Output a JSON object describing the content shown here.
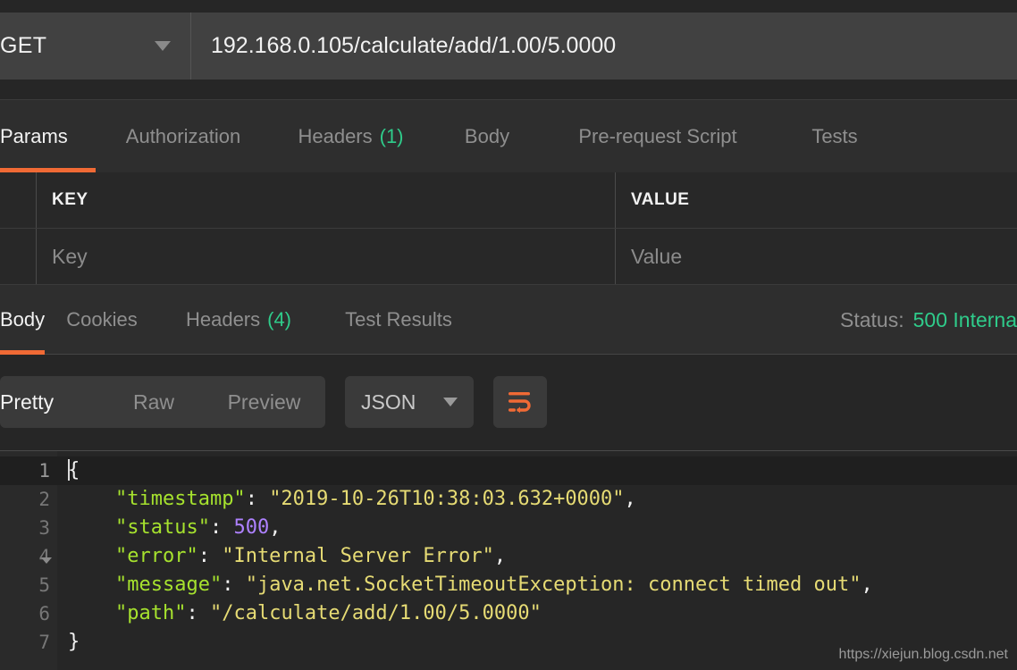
{
  "request": {
    "method": "GET",
    "method_caret_icon": "chevron-down-icon",
    "url": "192.168.0.105/calculate/add/1.00/5.0000",
    "tabs": [
      {
        "label": "Params",
        "count": "",
        "active": true
      },
      {
        "label": "Authorization",
        "count": "",
        "active": false
      },
      {
        "label": "Headers",
        "count": "(1)",
        "active": false
      },
      {
        "label": "Body",
        "count": "",
        "active": false
      },
      {
        "label": "Pre-request Script",
        "count": "",
        "active": false
      },
      {
        "label": "Tests",
        "count": "",
        "active": false
      }
    ]
  },
  "params_table": {
    "headers": {
      "key": "KEY",
      "value": "VALUE"
    },
    "placeholders": {
      "key": "Key",
      "value": "Value"
    }
  },
  "response": {
    "tabs": [
      {
        "label": "Body",
        "count": "",
        "active": true
      },
      {
        "label": "Cookies",
        "count": "",
        "active": false
      },
      {
        "label": "Headers",
        "count": "(4)",
        "active": false
      },
      {
        "label": "Test Results",
        "count": "",
        "active": false
      }
    ],
    "status_label": "Status:",
    "status_value": "500 Interna",
    "toolbar": {
      "view_modes": [
        {
          "label": "Pretty",
          "active": true
        },
        {
          "label": "Raw",
          "active": false
        },
        {
          "label": "Preview",
          "active": false
        }
      ],
      "format": "JSON",
      "format_caret_icon": "chevron-down-icon",
      "wrap_button_icon": "word-wrap-icon"
    },
    "body": {
      "line_numbers": [
        "1",
        "2",
        "3",
        "4",
        "5",
        "6",
        "7"
      ],
      "fold_icon": "chevron-down-icon",
      "lines": [
        [
          {
            "t": "{",
            "c": "punc"
          }
        ],
        [
          {
            "t": "    ",
            "c": "punc"
          },
          {
            "t": "\"timestamp\"",
            "c": "key"
          },
          {
            "t": ": ",
            "c": "punc"
          },
          {
            "t": "\"2019-10-26T10:38:03.632+0000\"",
            "c": "str"
          },
          {
            "t": ",",
            "c": "punc"
          }
        ],
        [
          {
            "t": "    ",
            "c": "punc"
          },
          {
            "t": "\"status\"",
            "c": "key"
          },
          {
            "t": ": ",
            "c": "punc"
          },
          {
            "t": "500",
            "c": "num"
          },
          {
            "t": ",",
            "c": "punc"
          }
        ],
        [
          {
            "t": "    ",
            "c": "punc"
          },
          {
            "t": "\"error\"",
            "c": "key"
          },
          {
            "t": ": ",
            "c": "punc"
          },
          {
            "t": "\"Internal Server Error\"",
            "c": "str"
          },
          {
            "t": ",",
            "c": "punc"
          }
        ],
        [
          {
            "t": "    ",
            "c": "punc"
          },
          {
            "t": "\"message\"",
            "c": "key"
          },
          {
            "t": ": ",
            "c": "punc"
          },
          {
            "t": "\"java.net.SocketTimeoutException: connect timed out\"",
            "c": "str"
          },
          {
            "t": ",",
            "c": "punc"
          }
        ],
        [
          {
            "t": "    ",
            "c": "punc"
          },
          {
            "t": "\"path\"",
            "c": "key"
          },
          {
            "t": ": ",
            "c": "punc"
          },
          {
            "t": "\"/calculate/add/1.00/5.0000\"",
            "c": "str"
          }
        ],
        [
          {
            "t": "}",
            "c": "punc"
          }
        ]
      ]
    }
  },
  "watermark": "https://xiejun.blog.csdn.net",
  "colors": {
    "accent": "#f06a35",
    "success": "#2fcc8b",
    "bg": "#262626",
    "panel": "#2e2e2e",
    "field": "#414141",
    "json_key": "#a6e22e",
    "json_string": "#e6db74",
    "json_number": "#ae81ff"
  }
}
